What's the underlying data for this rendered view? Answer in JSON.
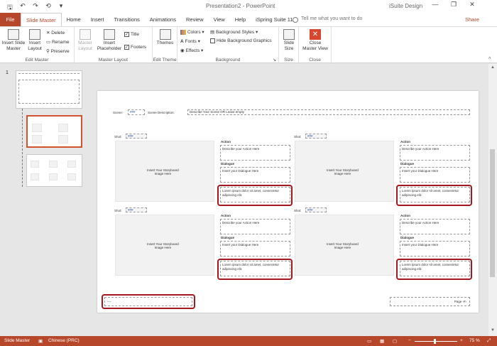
{
  "window": {
    "doc_title": "Presentation2 - PowerPoint",
    "user": "iSuite Design",
    "minimize": "—",
    "restore": "❐",
    "close": "✕"
  },
  "qat": {
    "save": "🖫",
    "undo": "↶",
    "redo": "↷",
    "start": "⟲",
    "customize": "▾"
  },
  "tabs": [
    "File",
    "Slide Master",
    "Home",
    "Insert",
    "Transitions",
    "Animations",
    "Review",
    "View",
    "Help",
    "iSpring Suite 11"
  ],
  "tell_me": "Tell me what you want to do",
  "share": "Share",
  "ribbon": {
    "edit_master": {
      "label": "Edit Master",
      "insert_slide_master": "Insert Slide\nMaster",
      "insert_layout": "Insert\nLayout",
      "delete": "Delete",
      "rename": "Rename",
      "preserve": "Preserve"
    },
    "master_layout": {
      "label": "Master Layout",
      "master_layout": "Master\nLayout",
      "insert_placeholder": "Insert\nPlaceholder",
      "title": "Title",
      "footers": "Footers",
      "title_checked": true,
      "footers_checked": true
    },
    "edit_theme": {
      "label": "Edit Theme",
      "themes": "Themes"
    },
    "background": {
      "label": "Background",
      "colors": "Colors",
      "fonts": "Fonts",
      "effects": "Effects",
      "background_styles": "Background Styles",
      "hide_background_graphics": "Hide Background Graphics"
    },
    "size": {
      "label": "Size",
      "slide_size": "Slide\nSize"
    },
    "close": {
      "label": "Close",
      "close_master_view": "Close\nMaster View"
    }
  },
  "thumbnails": {
    "slide_number": "1"
  },
  "slide": {
    "scene": "Scene:",
    "scene_num": "###",
    "scene_description": "Scene Description:",
    "scene_desc_text": "Describe Your Scene OR Leave empty",
    "shot": "Shot:",
    "shot_num": "###",
    "storyboard": "Insert Your Storyboard\nImage Here",
    "action": "Action",
    "action_text": "Describe your Action Here",
    "dialogue": "Dialogue",
    "dialogue_text": "Insert your Dialogue Here",
    "lorem": "Lorem ipsum dolor sit amet, consectetur adipiscing elit.",
    "footer": "----",
    "page": "Page ‹#›"
  },
  "status": {
    "view": "Slide Master",
    "language": "Chinese (PRC)",
    "zoom": "75 %"
  },
  "colors": {
    "accent": "#b7472a",
    "highlight": "#a4171e"
  }
}
